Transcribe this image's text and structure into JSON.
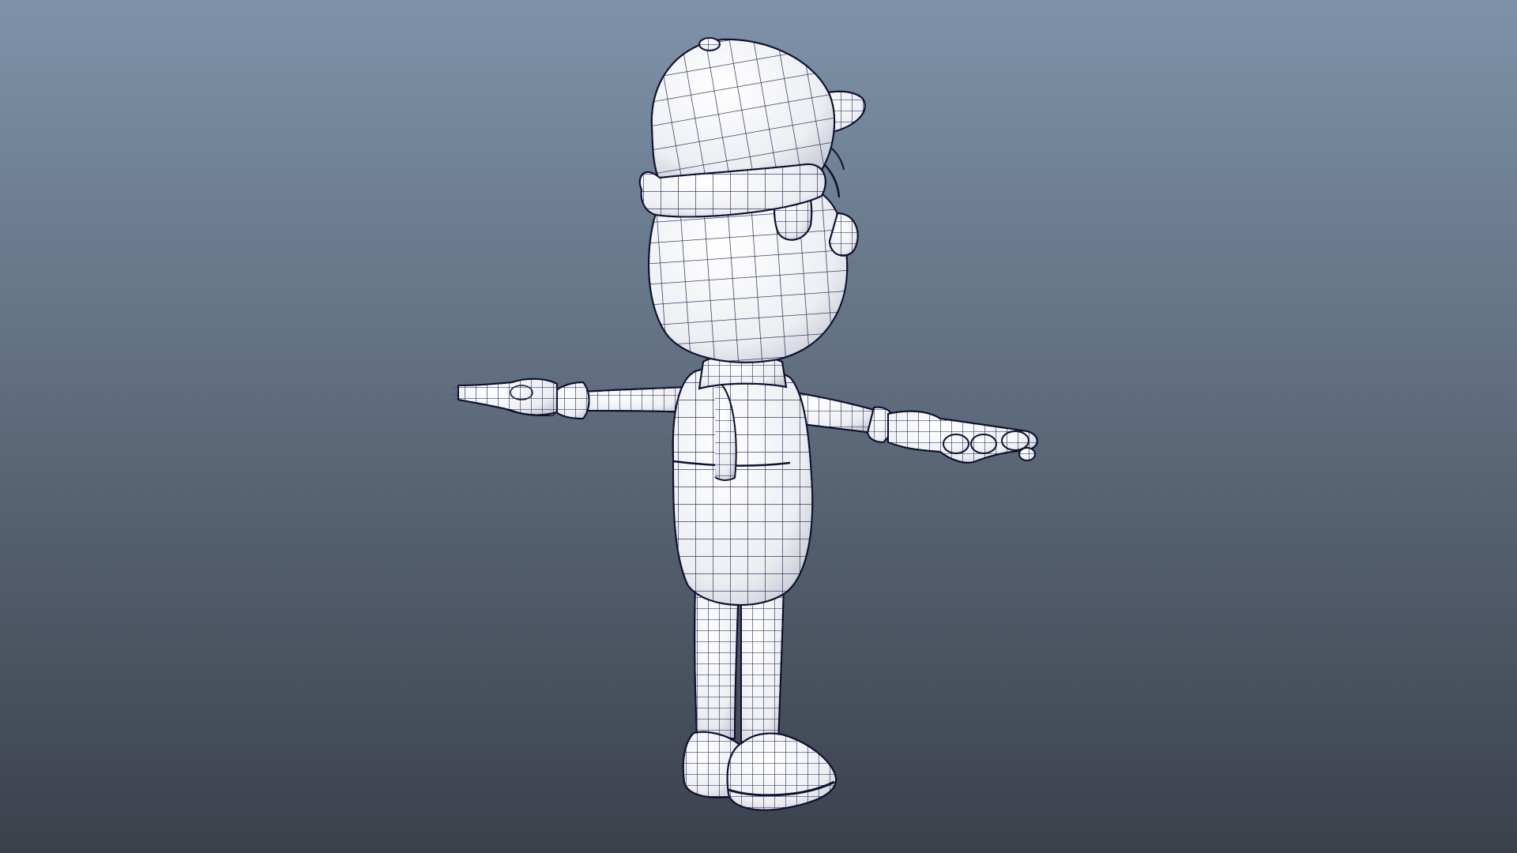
{
  "viewport": {
    "background_top": "#7e92a9",
    "background_bottom": "#3b414b"
  },
  "model": {
    "surface_color": "#ffffff",
    "shade_color": "#c9ccd4",
    "wire_color": "#1a1a4a",
    "outline_color": "#0f1130"
  },
  "icons": {
    "model": "character-wireframe-model"
  }
}
